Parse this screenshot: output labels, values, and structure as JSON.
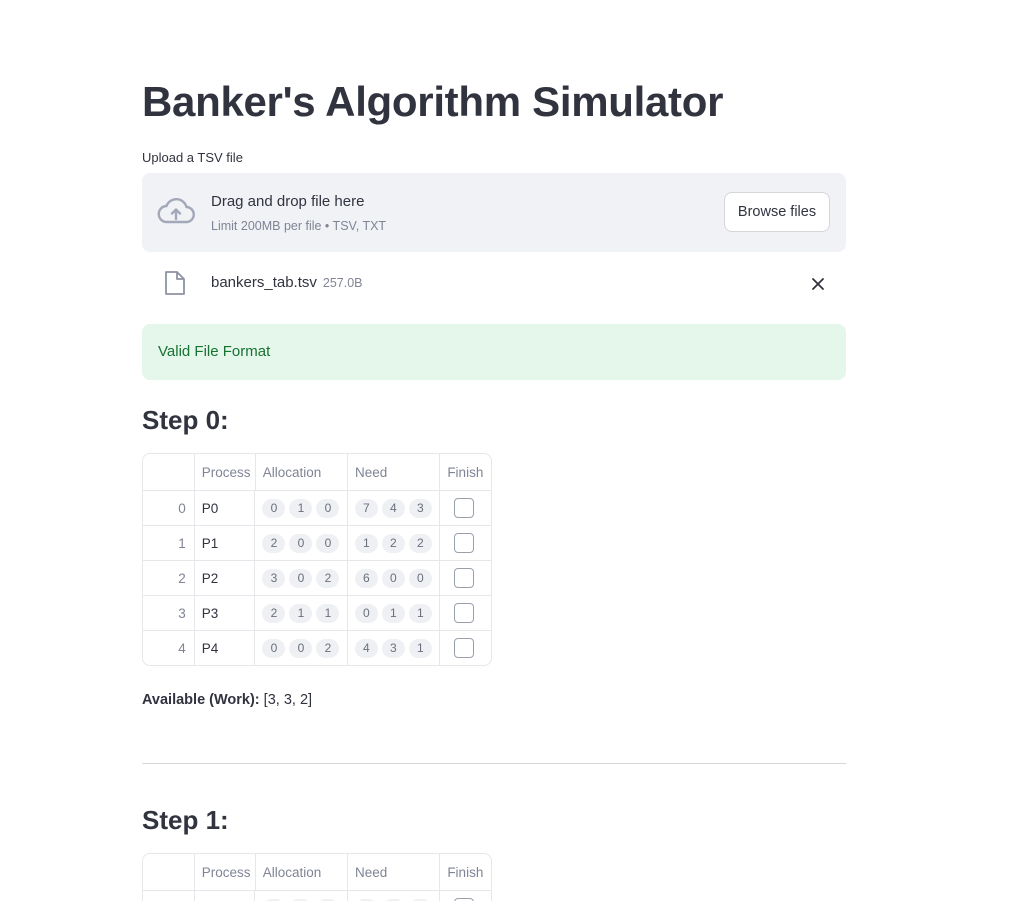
{
  "page": {
    "title": "Banker's Algorithm Simulator"
  },
  "uploader": {
    "label": "Upload a TSV file",
    "drop_title": "Drag and drop file here",
    "drop_subtitle": "Limit 200MB per file • TSV, TXT",
    "browse_label": "Browse files",
    "icon": "cloud-upload-icon"
  },
  "uploaded_file": {
    "name": "bankers_tab.tsv",
    "size": "257.0B",
    "icon": "file-icon",
    "remove_icon": "close-icon"
  },
  "status": {
    "message": "Valid File Format",
    "color": "#177233",
    "background": "#e5f6ea"
  },
  "steps": [
    {
      "heading": "Step 0:",
      "columns": [
        "",
        "Process",
        "Allocation",
        "Need",
        "Finish"
      ],
      "rows": [
        {
          "index": "0",
          "process": "P0",
          "allocation": [
            "0",
            "1",
            "0"
          ],
          "need": [
            "7",
            "4",
            "3"
          ],
          "finish": false
        },
        {
          "index": "1",
          "process": "P1",
          "allocation": [
            "2",
            "0",
            "0"
          ],
          "need": [
            "1",
            "2",
            "2"
          ],
          "finish": false
        },
        {
          "index": "2",
          "process": "P2",
          "allocation": [
            "3",
            "0",
            "2"
          ],
          "need": [
            "6",
            "0",
            "0"
          ],
          "finish": false
        },
        {
          "index": "3",
          "process": "P3",
          "allocation": [
            "2",
            "1",
            "1"
          ],
          "need": [
            "0",
            "1",
            "1"
          ],
          "finish": false
        },
        {
          "index": "4",
          "process": "P4",
          "allocation": [
            "0",
            "0",
            "2"
          ],
          "need": [
            "4",
            "3",
            "1"
          ],
          "finish": false
        }
      ],
      "available_label": "Available (Work):",
      "available_value": "[3, 3, 2]"
    },
    {
      "heading": "Step 1:",
      "columns": [
        "",
        "Process",
        "Allocation",
        "Need",
        "Finish"
      ]
    }
  ]
}
